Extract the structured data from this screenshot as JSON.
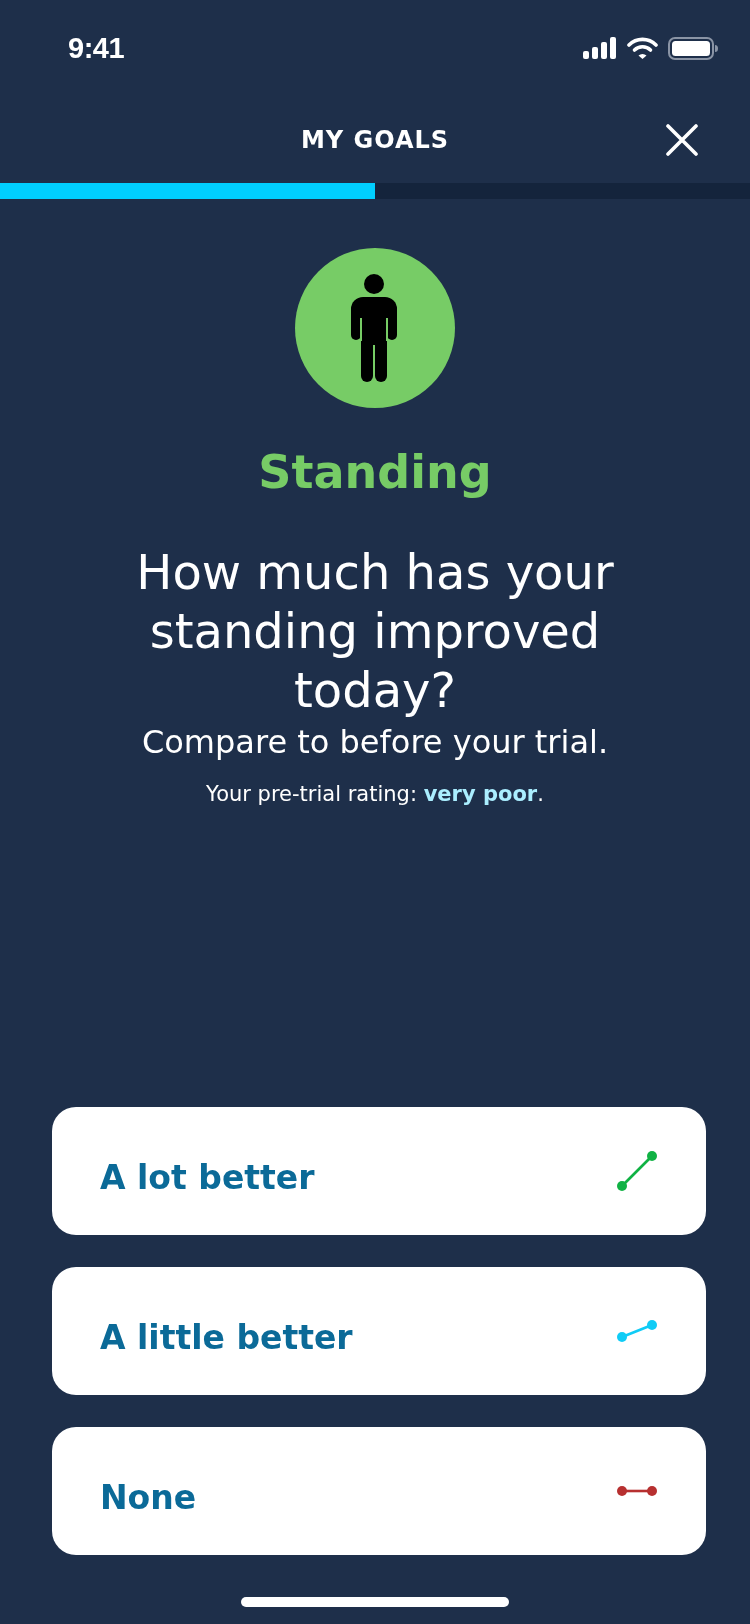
{
  "status_bar": {
    "time": "9:41"
  },
  "header": {
    "title": "MY GOALS"
  },
  "progress": {
    "level": 0.5
  },
  "goal": {
    "name": "Standing"
  },
  "question": {
    "text": "How much has your standing improved today?",
    "subtitle": "Compare to before your trial.",
    "note": "Your pre-trial rating: **very poor**."
  },
  "options": [
    {
      "label": "A lot better",
      "kind": "steep",
      "color": "#10b244",
      "selected": false
    },
    {
      "label": "A little better",
      "kind": "slight",
      "color": "#10ccf6",
      "selected": false
    },
    {
      "label": "None",
      "kind": "flat",
      "color": "#b73030",
      "selected": false
    }
  ]
}
